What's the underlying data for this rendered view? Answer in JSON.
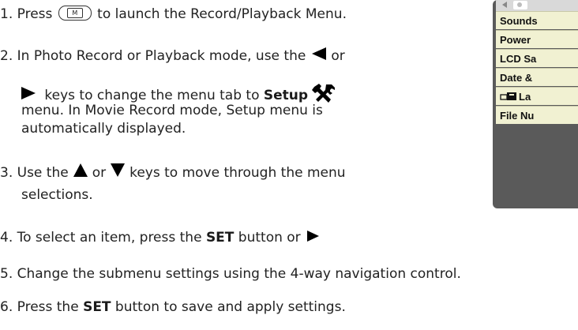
{
  "steps": {
    "s1_before": "1. Press ",
    "s1_key_label": "M",
    "s1_after": " to launch the Record/Playback Menu.",
    "s2_line1": "2. In Photo Record or Playback mode, use the",
    "s2_or": "or",
    "s2_line2_a": " keys to change the menu tab to ",
    "s2_line2_bold": "Setup",
    "s2_line3": "menu. In Movie Record mode, Setup menu is",
    "s2_line4": "automatically displayed.",
    "s3_a": "3. Use the",
    "s3_or": "or",
    "s3_b": "keys to move through the menu",
    "s3_line2": "selections.",
    "s4_a": "4. To select an item, press the ",
    "s4_bold": "SET",
    "s4_b": " button or ",
    "s5": "5. Change the submenu settings using the 4-way navigation control.",
    "s6_a": "6. Press the ",
    "s6_bold": "SET",
    "s6_b": " button to save and apply settings."
  },
  "menu": {
    "items": [
      "Sounds",
      "Power",
      "LCD Sa",
      "Date &",
      "La",
      "File Nu"
    ]
  }
}
